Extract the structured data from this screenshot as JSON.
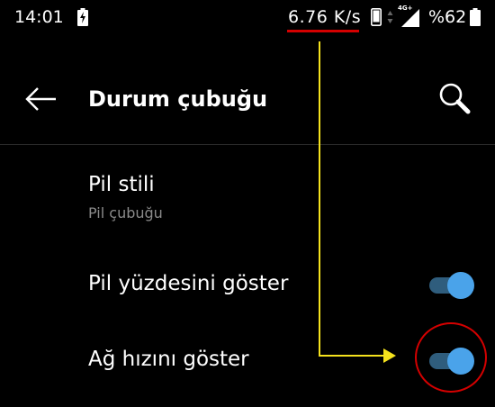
{
  "status_bar": {
    "time": "14:01",
    "network_speed": "6.76 K/s",
    "network_type": "4G+",
    "battery_percent": "%62",
    "icons": [
      "charging-icon",
      "phone-icon",
      "data-arrows-icon",
      "signal-icon",
      "battery-icon"
    ]
  },
  "toolbar": {
    "title": "Durum çubuğu",
    "back_icon": "back-arrow-icon",
    "search_icon": "search-icon"
  },
  "settings": {
    "battery_style": {
      "title": "Pil stili",
      "summary": "Pil çubuğu"
    },
    "show_battery_percent": {
      "title": "Pil yüzdesini göster",
      "enabled": true
    },
    "show_network_speed": {
      "title": "Ağ hızını göster",
      "enabled": true
    }
  },
  "colors": {
    "background": "#000000",
    "text": "#ffffff",
    "summary_text": "#8a8a8a",
    "toggle_thumb": "#4aa3ea",
    "toggle_track": "#2f5d7d",
    "annotation_red": "#d40000",
    "annotation_yellow": "#f5e21d"
  }
}
